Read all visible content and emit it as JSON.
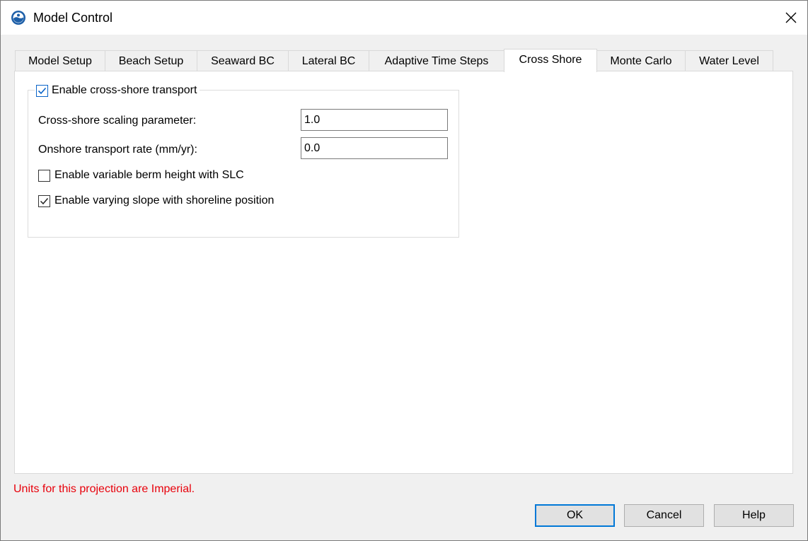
{
  "window": {
    "title": "Model Control",
    "app_icon": "globe-icon",
    "close_icon": "close-icon"
  },
  "tabs": [
    {
      "label": "Model Setup",
      "active": false
    },
    {
      "label": "Beach Setup",
      "active": false
    },
    {
      "label": "Seaward BC",
      "active": false
    },
    {
      "label": "Lateral BC",
      "active": false
    },
    {
      "label": "Adaptive Time Steps",
      "active": false
    },
    {
      "label": "Cross Shore",
      "active": true
    },
    {
      "label": "Monte Carlo",
      "active": false
    },
    {
      "label": "Water Level",
      "active": false
    }
  ],
  "cross_shore": {
    "enable_transport": {
      "label": "Enable cross-shore transport",
      "checked": true
    },
    "scaling": {
      "label": "Cross-shore scaling parameter:",
      "value": "1.0"
    },
    "onshore_rate": {
      "label": "Onshore transport rate (mm/yr):",
      "value": "0.0"
    },
    "variable_berm": {
      "label": "Enable variable berm height with SLC",
      "checked": false
    },
    "varying_slope": {
      "label": "Enable varying slope with shoreline position",
      "checked": true
    }
  },
  "footer": {
    "units_note": "Units for this projection are Imperial.",
    "units_note_color": "#e8000b",
    "ok": "OK",
    "cancel": "Cancel",
    "help": "Help"
  },
  "colors": {
    "accent": "#0078d7",
    "check_blue": "#0a64c8"
  }
}
